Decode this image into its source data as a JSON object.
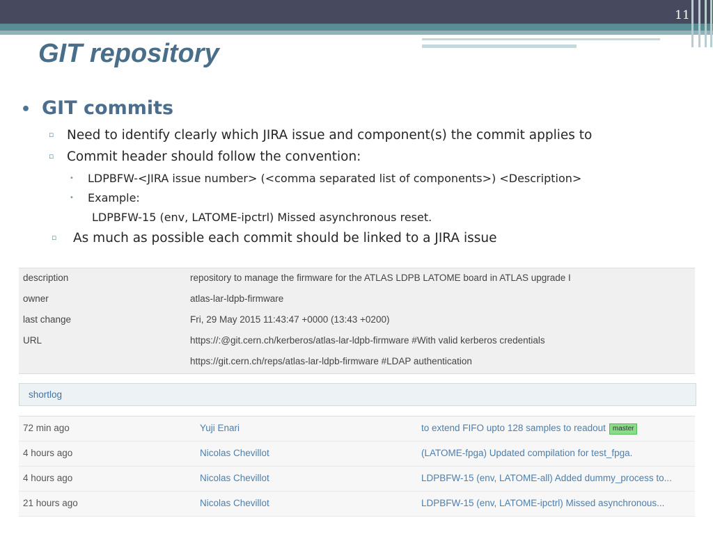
{
  "slide": {
    "page_number": "11",
    "title": "GIT repository"
  },
  "bullets": {
    "heading": "GIT commits",
    "items": [
      "Need to identify clearly which JIRA issue and component(s) the commit applies to",
      "Commit header should follow the convention:"
    ],
    "subitems": [
      "LDPBFW-<JIRA issue number> (<comma separated list of components>) <Description>",
      "Example:"
    ],
    "example_text": "LDPBFW-15 (env, LATOME-ipctrl) Missed asynchronous reset.",
    "last_item": "As much as possible each commit should be linked to a JIRA issue"
  },
  "project": {
    "rows": [
      {
        "key": "description",
        "value": "repository to manage the firmware for the ATLAS LDPB LATOME board in ATLAS upgrade I"
      },
      {
        "key": "owner",
        "value": "atlas-lar-ldpb-firmware"
      },
      {
        "key": "last change",
        "value": "Fri, 29 May 2015 11:43:47 +0000 (13:43 +0200)"
      },
      {
        "key": "URL",
        "value": "https://:@git.cern.ch/kerberos/atlas-lar-ldpb-firmware #With valid kerberos credentials"
      },
      {
        "key": "",
        "value": "https://git.cern.ch/reps/atlas-lar-ldpb-firmware #LDAP authentication"
      }
    ]
  },
  "shortlog": {
    "label": "shortlog",
    "rows": [
      {
        "age": "72 min ago",
        "author": "Yuji Enari",
        "message": "to extend FIFO upto 128 samples to readout",
        "badge": "master"
      },
      {
        "age": "4 hours ago",
        "author": "Nicolas Chevillot",
        "message": "(LATOME-fpga) Updated compilation for test_fpga.",
        "badge": ""
      },
      {
        "age": "4 hours ago",
        "author": "Nicolas Chevillot",
        "message": "LDPBFW-15 (env, LATOME-all) Added dummy_process to...",
        "badge": ""
      },
      {
        "age": "21 hours ago",
        "author": "Nicolas Chevillot",
        "message": "LDPBFW-15 (env, LATOME-ipctrl) Missed asynchronous...",
        "badge": ""
      }
    ]
  }
}
